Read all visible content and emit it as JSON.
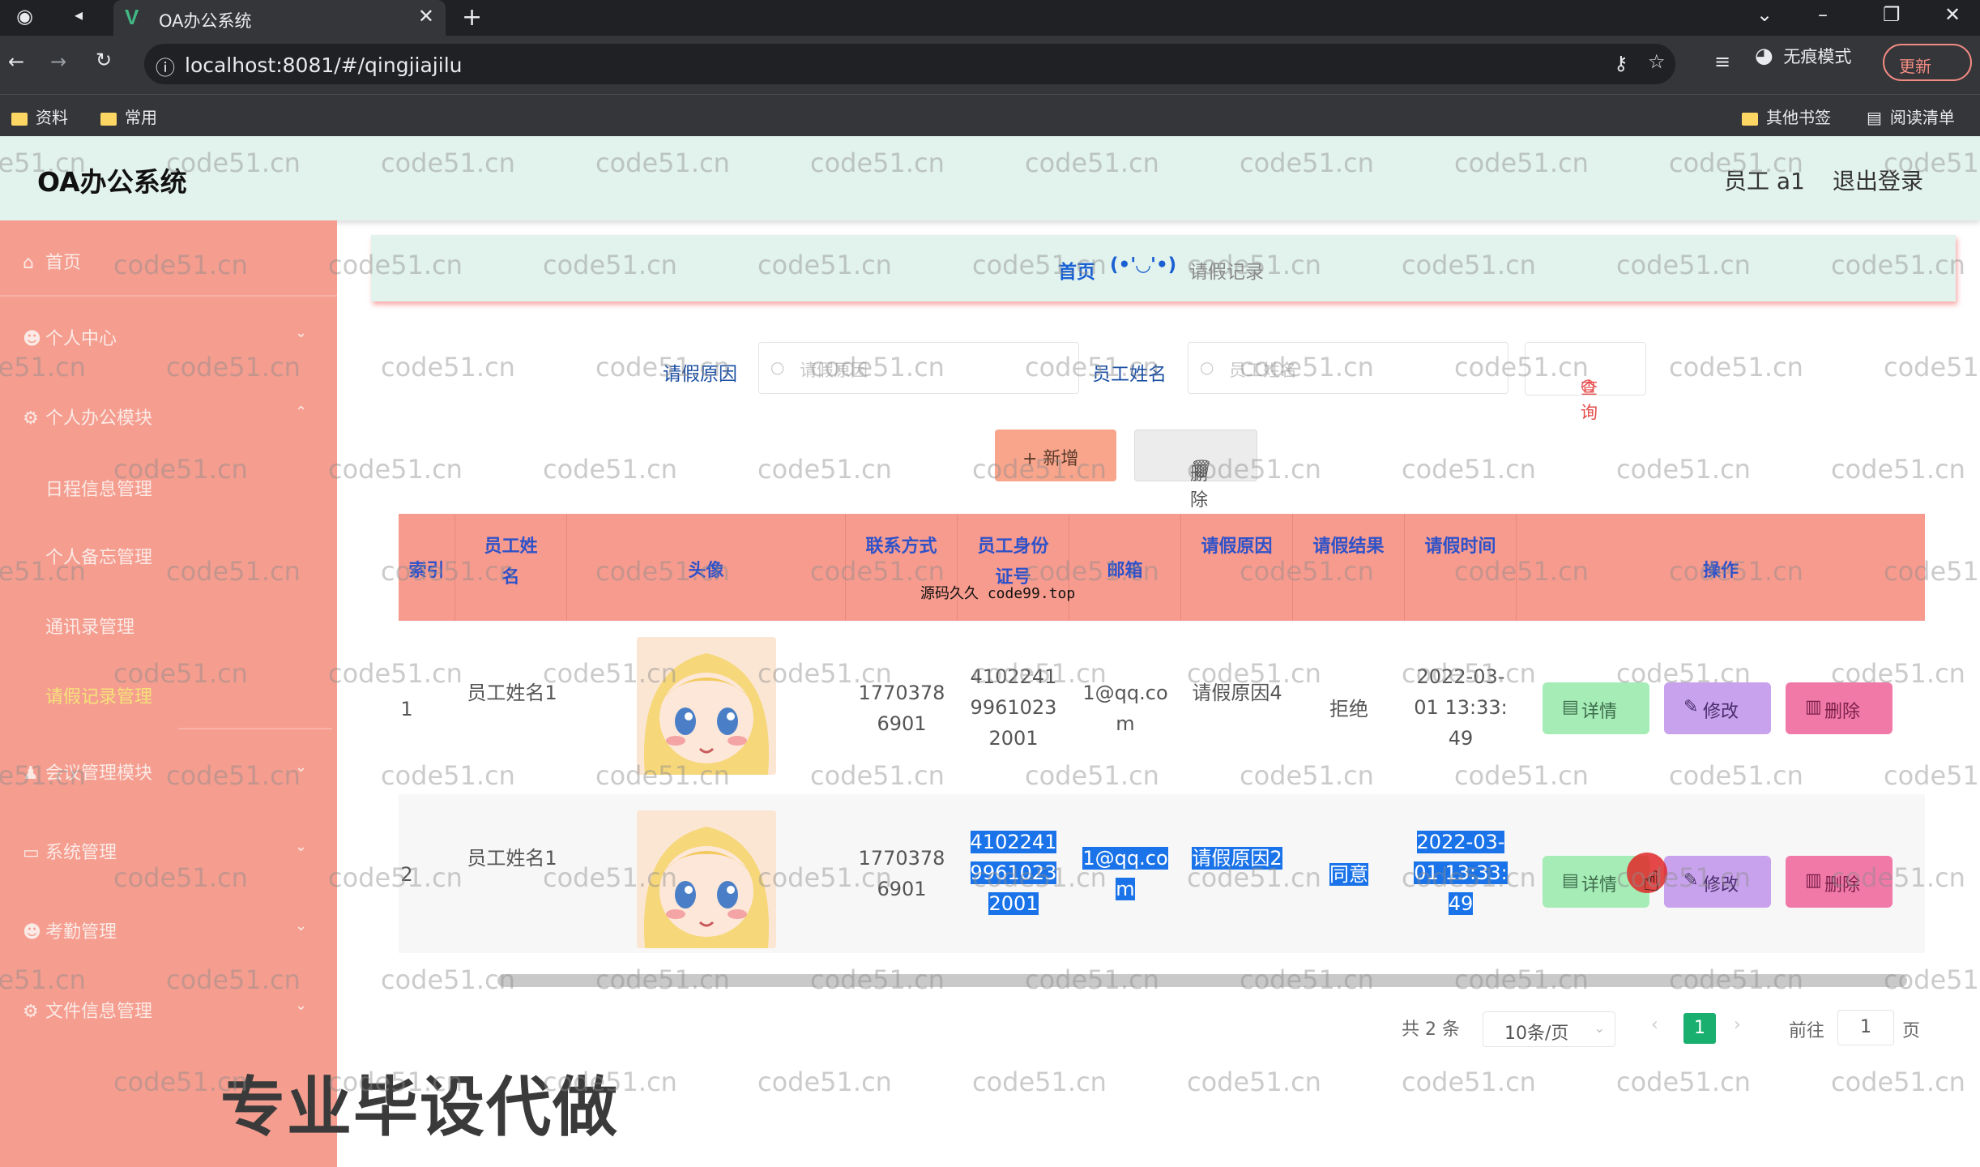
{
  "browser": {
    "tab_title": "OA办公系统",
    "url": "localhost:8081/#/qingjiajilu",
    "incognito_label": "无痕模式",
    "update_label": "更新",
    "bookmarks": [
      "资料",
      "常用"
    ],
    "other_bookmarks": "其他书签",
    "reading_list": "阅读清单"
  },
  "header": {
    "title": "OA办公系统",
    "user": "员工 a1",
    "logout": "退出登录"
  },
  "sidebar": {
    "items": [
      {
        "label": "首页",
        "icon": "home-icon"
      },
      {
        "label": "个人中心",
        "icon": "user-icon"
      },
      {
        "label": "个人办公模块",
        "icon": "settings-icon"
      },
      {
        "label": "会议管理模块",
        "icon": "people-icon"
      },
      {
        "label": "系统管理",
        "icon": "monitor-icon"
      },
      {
        "label": "考勤管理",
        "icon": "user-icon"
      },
      {
        "label": "文件信息管理",
        "icon": "settings-icon"
      }
    ],
    "submenu": [
      "日程信息管理",
      "个人备忘管理",
      "通讯录管理",
      "请假记录管理"
    ]
  },
  "breadcrumb": {
    "home": "首页",
    "separator": "(•'◡'•)",
    "current": "请假记录"
  },
  "search": {
    "reason_label": "请假原因",
    "reason_placeholder": "请假原因",
    "name_label": "员工姓名",
    "name_placeholder": "员工姓名",
    "query_label": "查询"
  },
  "actions": {
    "add": "+ 新增",
    "delete": "删除"
  },
  "table": {
    "columns": [
      "索引",
      "员工姓名",
      "头像",
      "联系方式",
      "员工身份证号",
      "邮箱",
      "请假原因",
      "请假结果",
      "请假时间",
      "操作"
    ],
    "rows": [
      {
        "index": "1",
        "name": "员工姓名1",
        "phone": "17703786901",
        "idcard": "410224199610232001",
        "email": "1@qq.com",
        "reason": "请假原因4",
        "result": "拒绝",
        "time": "2022-03-01 13:33:49"
      },
      {
        "index": "2",
        "name": "员工姓名1",
        "phone": "17703786901",
        "idcard": "410224199610232001",
        "email": "1@qq.com",
        "reason": "请假原因2",
        "result": "同意",
        "time": "2022-03-01 13:33:49"
      }
    ],
    "row_actions": [
      "详情",
      "修改",
      "删除"
    ]
  },
  "pagination": {
    "total": "共 2 条",
    "page_size": "10条/页",
    "current_page": "1",
    "goto_label": "前往",
    "goto_value": "1",
    "page_suffix": "页"
  },
  "overlay": {
    "watermark": "code51.cn",
    "source_mark": "源码久久 code99.top",
    "promo": "专业毕设代做"
  },
  "colors": {
    "sidebar": "#f59d8f",
    "header": "#e2f2ec",
    "table_header": "#f79b8e",
    "detail": "#a6ecb6",
    "edit": "#c8a2ec",
    "remove": "#f179a8",
    "page_active": "#19b06f"
  }
}
